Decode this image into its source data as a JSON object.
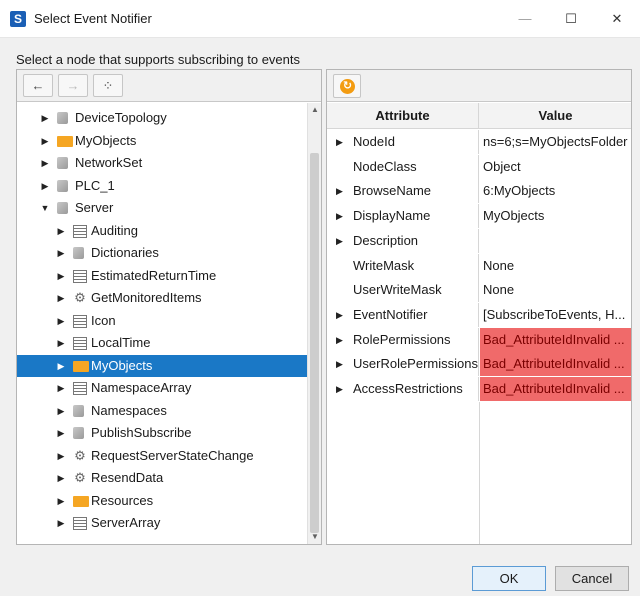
{
  "window": {
    "title": "Select Event Notifier",
    "icon_letter": "S",
    "minimize": "—",
    "maximize": "☐",
    "close": "✕"
  },
  "instruction": "Select a node that supports subscribing to events",
  "left_toolbar": {
    "back": "←",
    "forward": "→",
    "hierarchy": "⁘"
  },
  "tree": [
    {
      "label": "DeviceTopology",
      "icon": "cube-icon",
      "level": 0,
      "expanded": false
    },
    {
      "label": "MyObjects",
      "icon": "folder-icon",
      "level": 0,
      "expanded": false
    },
    {
      "label": "NetworkSet",
      "icon": "cube-icon",
      "level": 0,
      "expanded": false
    },
    {
      "label": "PLC_1",
      "icon": "cube-icon",
      "level": 0,
      "expanded": false
    },
    {
      "label": "Server",
      "icon": "cube-icon",
      "level": 0,
      "expanded": true
    },
    {
      "label": "Auditing",
      "icon": "list-icon",
      "level": 1,
      "expanded": false
    },
    {
      "label": "Dictionaries",
      "icon": "cube-icon",
      "level": 1,
      "expanded": false
    },
    {
      "label": "EstimatedReturnTime",
      "icon": "list-icon",
      "level": 1,
      "expanded": false
    },
    {
      "label": "GetMonitoredItems",
      "icon": "gear-icon",
      "level": 1,
      "expanded": false
    },
    {
      "label": "Icon",
      "icon": "list-icon",
      "level": 1,
      "expanded": false
    },
    {
      "label": "LocalTime",
      "icon": "list-icon",
      "level": 1,
      "expanded": false
    },
    {
      "label": "MyObjects",
      "icon": "folder-icon",
      "level": 1,
      "expanded": false,
      "selected": true
    },
    {
      "label": "NamespaceArray",
      "icon": "list-icon",
      "level": 1,
      "expanded": false
    },
    {
      "label": "Namespaces",
      "icon": "cube-icon",
      "level": 1,
      "expanded": false
    },
    {
      "label": "PublishSubscribe",
      "icon": "cube-icon",
      "level": 1,
      "expanded": false
    },
    {
      "label": "RequestServerStateChange",
      "icon": "gear-icon",
      "level": 1,
      "expanded": false
    },
    {
      "label": "ResendData",
      "icon": "gear-icon",
      "level": 1,
      "expanded": false
    },
    {
      "label": "Resources",
      "icon": "folder-icon",
      "level": 1,
      "expanded": false
    },
    {
      "label": "ServerArray",
      "icon": "list-icon",
      "level": 1,
      "expanded": false
    }
  ],
  "attributes": {
    "header_attribute": "Attribute",
    "header_value": "Value",
    "rows": [
      {
        "name": "NodeId",
        "value": "ns=6;s=MyObjectsFolder",
        "expandable": true,
        "error": false
      },
      {
        "name": "NodeClass",
        "value": "Object",
        "expandable": false,
        "error": false
      },
      {
        "name": "BrowseName",
        "value": "6:MyObjects",
        "expandable": true,
        "error": false
      },
      {
        "name": "DisplayName",
        "value": "MyObjects",
        "expandable": true,
        "error": false
      },
      {
        "name": "Description",
        "value": "",
        "expandable": true,
        "error": false
      },
      {
        "name": "WriteMask",
        "value": "None",
        "expandable": false,
        "error": false
      },
      {
        "name": "UserWriteMask",
        "value": "None",
        "expandable": false,
        "error": false
      },
      {
        "name": "EventNotifier",
        "value": "[SubscribeToEvents, H...",
        "expandable": true,
        "error": false
      },
      {
        "name": "RolePermissions",
        "value": "Bad_AttributeIdInvalid ...",
        "expandable": true,
        "error": true
      },
      {
        "name": "UserRolePermissions",
        "value": "Bad_AttributeIdInvalid ...",
        "expandable": true,
        "error": true
      },
      {
        "name": "AccessRestrictions",
        "value": "Bad_AttributeIdInvalid ...",
        "expandable": true,
        "error": true
      }
    ]
  },
  "buttons": {
    "ok": "OK",
    "cancel": "Cancel"
  },
  "colors": {
    "selection": "#1a78c6",
    "error": "#f06a6a",
    "folder": "#f5a623",
    "refresh": "#f39c12"
  }
}
